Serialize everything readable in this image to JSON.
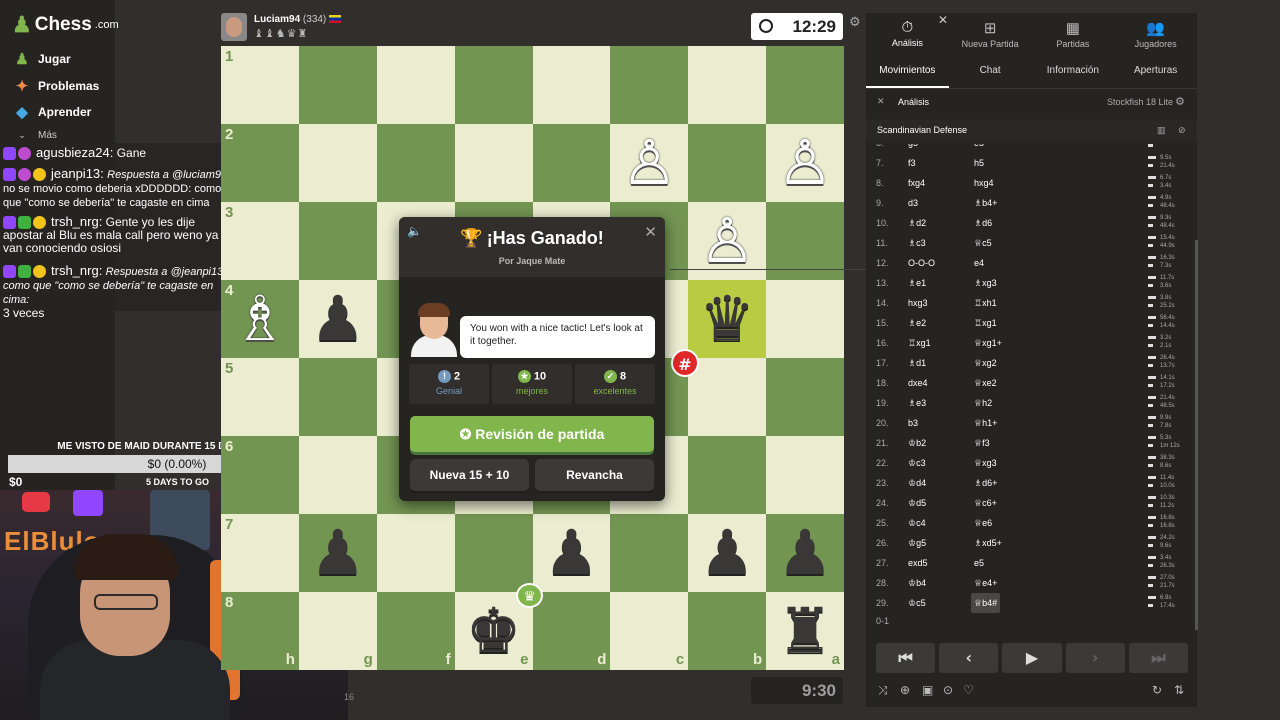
{
  "nav": {
    "logo": "Chess",
    "logo_suffix": ".com",
    "items": [
      {
        "label": "Jugar",
        "icon": "play-icon"
      },
      {
        "label": "Problemas",
        "icon": "puzzle-icon"
      },
      {
        "label": "Aprender",
        "icon": "learn-icon"
      },
      {
        "label": "Más",
        "icon": "more-icon"
      }
    ]
  },
  "chat": {
    "messages": [
      {
        "user": "agusbieza24:",
        "text": "Gane"
      },
      {
        "user": "jeanpi13:",
        "reply": "Respuesta a @luciam94",
        "text": "no se movio como deberia xDDDDDD:  como que \"como se debería\" te cagaste en cima"
      },
      {
        "user": "trsh_nrg:",
        "text": "Gente yo les dije apostar al Blu es mala call pero weno ya van conociendo osiosi"
      },
      {
        "user": "trsh_nrg:",
        "reply": "Respuesta a @jeanpi13:",
        "text": "como que \"como se debería\" te cagaste en cima:",
        "text2": "3 veces"
      }
    ]
  },
  "goal": {
    "title": "ME VISTO DE MAID DURANTE 15 DÍAS SEGUIDOS",
    "amount": "$0 (0.00%)",
    "min": "$0",
    "sub": "5 DAYS TO GO",
    "progress": 0
  },
  "stream": {
    "brand": "ElBlulo"
  },
  "player": {
    "name": "Luciam94",
    "rating": "(334)",
    "captured": "♝♝♞♛♜",
    "clock_top": "12:29",
    "clock_bottom": "9:30"
  },
  "board": {
    "ranks": [
      "1",
      "2",
      "3",
      "4",
      "5",
      "6",
      "7",
      "8"
    ],
    "files": [
      "h",
      "g",
      "f",
      "e",
      "d",
      "c",
      "b",
      "a"
    ]
  },
  "modal": {
    "title": "¡Has Ganado!",
    "subtitle": "Por Jaque Mate",
    "coach_text": "You won with a nice tactic! Let's look at it together.",
    "stats": [
      {
        "value": "2",
        "label": "Genial",
        "color": "#749bbf",
        "icon": "!"
      },
      {
        "value": "10",
        "label": "mejores",
        "color": "#81b64c",
        "icon": "★"
      },
      {
        "value": "8",
        "label": "excelentes",
        "color": "#81b64c",
        "icon": "👍"
      }
    ],
    "review_label": "Revisión de partida",
    "new_game_label": "Nueva 15 + 10",
    "rematch_label": "Revancha"
  },
  "panel": {
    "tabs": [
      {
        "label": "Análisis",
        "icon": "analysis-icon"
      },
      {
        "label": "Nueva Partida",
        "icon": "plus-icon"
      },
      {
        "label": "Partidas",
        "icon": "games-icon"
      },
      {
        "label": "Jugadores",
        "icon": "players-icon"
      }
    ],
    "subtabs": [
      "Movimientos",
      "Chat",
      "Información",
      "Aperturas"
    ],
    "engine_label": "Análisis",
    "engine_name": "Stockfish 18 Lite",
    "opening": "Scandinavian Defense",
    "moves": [
      {
        "n": "6.",
        "w": "g5",
        "b": "e5",
        "t1": "48.4s",
        "t2": ""
      },
      {
        "n": "7.",
        "w": "f3",
        "b": "h5",
        "t1": "9.5s",
        "t2": "21.4s"
      },
      {
        "n": "8.",
        "w": "fxg4",
        "b": "hxg4",
        "t1": "6.7s",
        "t2": "3.4s"
      },
      {
        "n": "9.",
        "w": "d3",
        "b": "♗b4+",
        "t1": "4.9s",
        "t2": "48.4s"
      },
      {
        "n": "10.",
        "w": "♗d2",
        "b": "♗d6",
        "t1": "9.3s",
        "t2": "48.4s"
      },
      {
        "n": "11.",
        "w": "♗c3",
        "b": "♕c5",
        "t1": "15.4s",
        "t2": "44.9s"
      },
      {
        "n": "12.",
        "w": "O-O-O",
        "b": "e4",
        "t1": "16.3s",
        "t2": "7.3s"
      },
      {
        "n": "13.",
        "w": "♗e1",
        "b": "♗xg3",
        "t1": "11.7s",
        "t2": "3.6s"
      },
      {
        "n": "14.",
        "w": "hxg3",
        "b": "♖xh1",
        "t1": "3.8s",
        "t2": "25.2s"
      },
      {
        "n": "15.",
        "w": "♗e2",
        "b": "♖xg1",
        "t1": "56.4s",
        "t2": "14.4s"
      },
      {
        "n": "16.",
        "w": "♖xg1",
        "b": "♕xg1+",
        "t1": "3.2s",
        "t2": "2.1s"
      },
      {
        "n": "17.",
        "w": "♗d1",
        "b": "♕xg2",
        "t1": "26.4s",
        "t2": "13.7s"
      },
      {
        "n": "18.",
        "w": "dxe4",
        "b": "♕xe2",
        "t1": "14.1s",
        "t2": "17.2s"
      },
      {
        "n": "19.",
        "w": "♗e3",
        "b": "♕h2",
        "t1": "21.4s",
        "t2": "48.5s"
      },
      {
        "n": "20.",
        "w": "b3",
        "b": "♕h1+",
        "t1": "9.9s",
        "t2": "7.8s"
      },
      {
        "n": "21.",
        "w": "♔b2",
        "b": "♕f3",
        "t1": "5.3s",
        "t2": "1m 12s"
      },
      {
        "n": "22.",
        "w": "♔c3",
        "b": "♕xg3",
        "t1": "38.3s",
        "t2": "8.6s"
      },
      {
        "n": "23.",
        "w": "♔d4",
        "b": "♗d6+",
        "t1": "11.4s",
        "t2": "10.0s"
      },
      {
        "n": "24.",
        "w": "♔d5",
        "b": "♕c6+",
        "t1": "10.3s",
        "t2": "11.2s"
      },
      {
        "n": "25.",
        "w": "♔c4",
        "b": "♕e6",
        "t1": "16.8s",
        "t2": "16.8s"
      },
      {
        "n": "26.",
        "w": "♔g5",
        "b": "♗xd5+",
        "t1": "24.2s",
        "t2": "9.6s"
      },
      {
        "n": "27.",
        "w": "exd5",
        "b": "e5",
        "t1": "3.4s",
        "t2": "26.3s"
      },
      {
        "n": "28.",
        "w": "♔b4",
        "b": "♕e4+",
        "t1": "27.0s",
        "t2": "21.7s"
      },
      {
        "n": "29.",
        "w": "♔c5",
        "b": "♕b4#",
        "t1": "6.9s",
        "t2": "17.4s"
      }
    ],
    "result": "0-1"
  },
  "misc": {
    "bottom_num": "16"
  }
}
